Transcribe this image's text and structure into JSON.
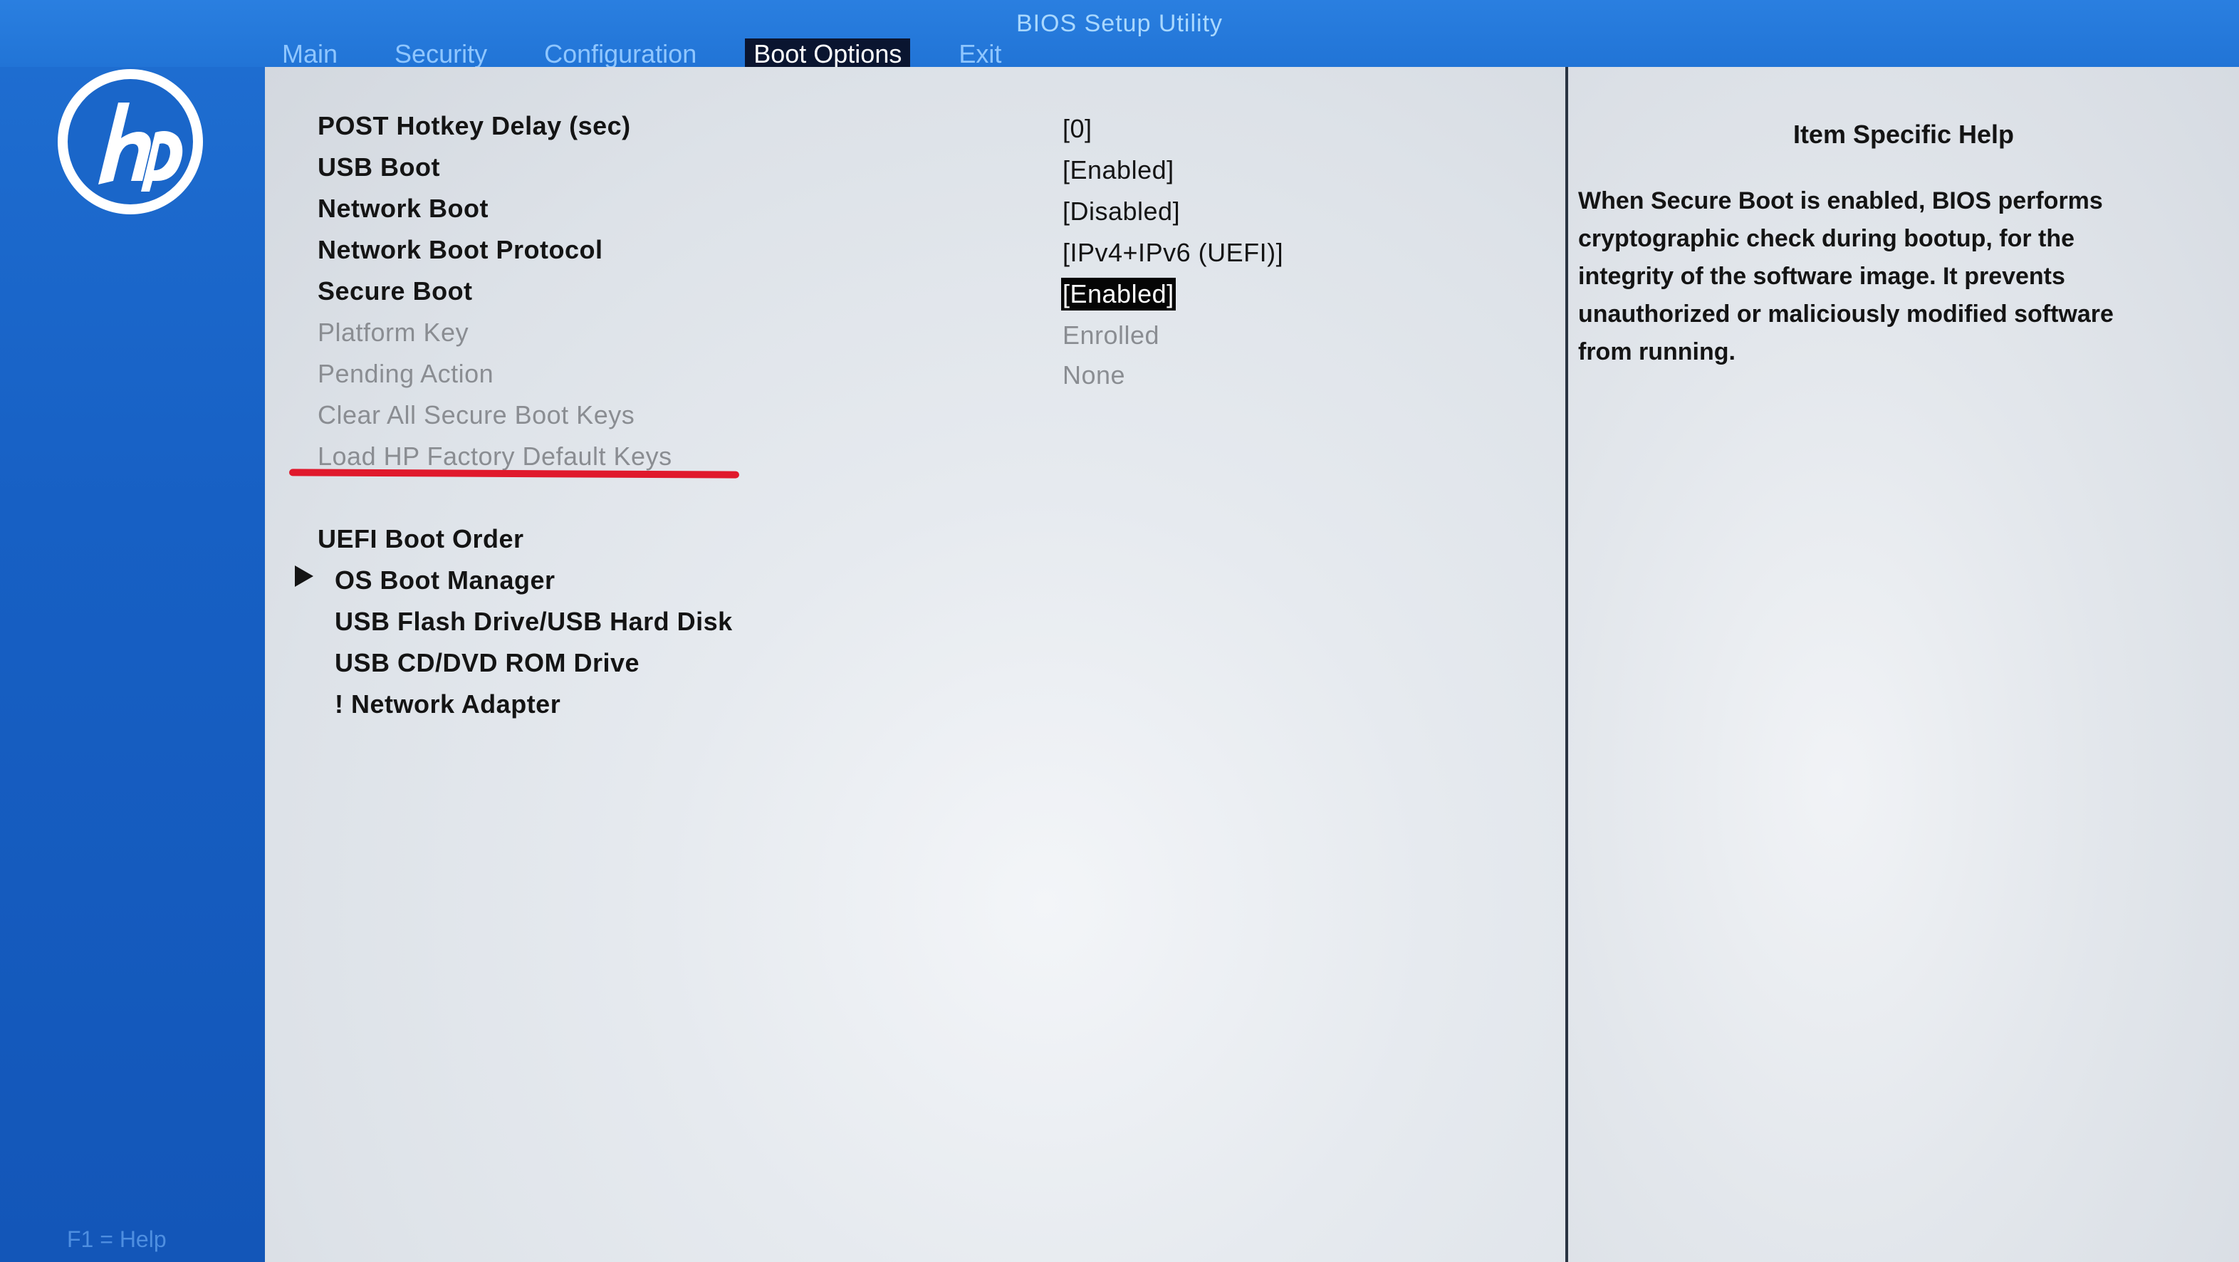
{
  "app": {
    "title": "BIOS Setup Utility"
  },
  "tabs": [
    {
      "label": "Main",
      "active": false
    },
    {
      "label": "Security",
      "active": false
    },
    {
      "label": "Configuration",
      "active": false
    },
    {
      "label": "Boot Options",
      "active": true
    },
    {
      "label": "Exit",
      "active": false
    }
  ],
  "logo": {
    "text": "hp",
    "icon": "hp-logo-icon",
    "color": "#ffffff"
  },
  "footer": {
    "f1_help": "F1 = Help"
  },
  "settings": [
    {
      "label": "POST Hotkey Delay (sec)",
      "value": "[0]",
      "state": "normal"
    },
    {
      "label": "USB Boot",
      "value": "[Enabled]",
      "state": "normal"
    },
    {
      "label": "Network Boot",
      "value": "[Disabled]",
      "state": "normal"
    },
    {
      "label": "Network Boot Protocol",
      "value": "[IPv4+IPv6 (UEFI)]",
      "state": "normal"
    },
    {
      "label": "Secure Boot",
      "value": "[Enabled]",
      "state": "selected"
    },
    {
      "label": "Platform Key",
      "value": "Enrolled",
      "state": "disabled"
    },
    {
      "label": "Pending Action",
      "value": "None",
      "state": "disabled"
    },
    {
      "label": "Clear All Secure Boot Keys",
      "value": "",
      "state": "disabled"
    },
    {
      "label": "Load HP Factory Default Keys",
      "value": "",
      "state": "disabled",
      "annotated": true
    }
  ],
  "boot_order": {
    "title": "UEFI Boot Order",
    "items": [
      {
        "label": "OS Boot Manager",
        "expandable": true
      },
      {
        "label": "USB Flash Drive/USB Hard Disk",
        "expandable": false
      },
      {
        "label": "USB CD/DVD ROM Drive",
        "expandable": false
      },
      {
        "label": "! Network Adapter",
        "expandable": false
      }
    ]
  },
  "help": {
    "title": "Item Specific Help",
    "lines": [
      "When Secure Boot is enabled, BIOS performs",
      "cryptographic check during bootup, for the",
      "integrity of the software image.  It prevents",
      "unauthorized or maliciously modified software",
      "from running."
    ]
  },
  "colors": {
    "header_blue": "#2174d6",
    "tab_text": "#8fc6ff",
    "active_tab_bg": "#0a1530",
    "annotation_red": "#e0192c",
    "disabled_text": "#8a8d92"
  }
}
